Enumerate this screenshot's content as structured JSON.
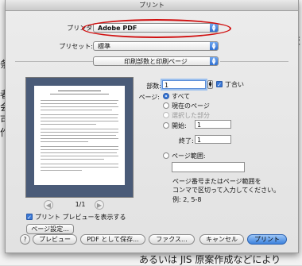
{
  "window": {
    "title": "プリント"
  },
  "background_text": {
    "right_1": "技",
    "left_1": "条",
    "left_2": "者",
    "left_3": "会",
    "left_4": "可",
    "left_5": "作",
    "bottom": "あるいは JIS 原案作成などにより"
  },
  "printer": {
    "label": "プリンタ:",
    "value": "Adobe PDF"
  },
  "preset": {
    "label": "プリセット:",
    "value": "標準"
  },
  "panel": {
    "value": "印刷部数と印刷ページ"
  },
  "preview": {
    "page_indicator": "1/1",
    "show_preview_label": "プリント プレビューを表示する",
    "page_setup_button": "ページ設定..."
  },
  "copies": {
    "label": "部数:",
    "value": "1",
    "collate_label": "丁合い"
  },
  "pages": {
    "label": "ページ:",
    "all": "すべて",
    "current": "現在のページ",
    "selection": "選択した部分",
    "from_label": "開始:",
    "from_value": "1",
    "to_label": "終了:",
    "to_value": "1",
    "range_label": "ページ範囲:",
    "range_value": "",
    "hint_line1": "ページ番号またはページ範囲を",
    "hint_line2": "コンマで区切って入力してください。",
    "hint_example": "例: 2, 5-8"
  },
  "footer": {
    "help": "?",
    "preview_button": "プレビュー",
    "save_pdf_button": "PDF として保存...",
    "fax_button": "ファクス...",
    "cancel_button": "キャンセル",
    "print_button": "プリント"
  },
  "colors": {
    "accent": "#3a78d6",
    "highlight_ellipse": "#d01010"
  }
}
